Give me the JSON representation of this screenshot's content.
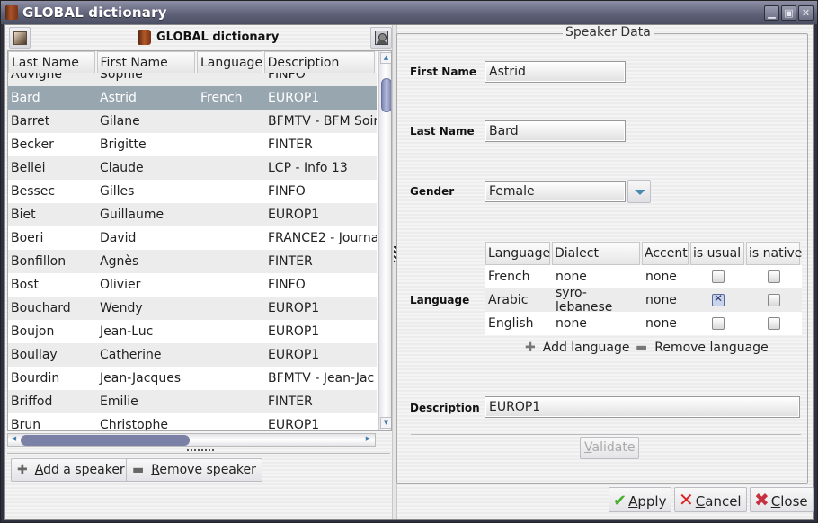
{
  "window": {
    "title": "GLOBAL dictionary",
    "controls": [
      "minimize",
      "maximize",
      "close"
    ]
  },
  "left_panel": {
    "title": "GLOBAL dictionary",
    "columns": [
      "Last Name",
      "First Name",
      "Language",
      "Description"
    ],
    "rows": [
      {
        "last": "Auvigne",
        "first": "Sophie",
        "language": "",
        "description": "FINFO"
      },
      {
        "last": "Bard",
        "first": "Astrid",
        "language": "French",
        "description": "EUROP1",
        "selected": true
      },
      {
        "last": "Barret",
        "first": "Gilane",
        "language": "",
        "description": "BFMTV - BFM Soir"
      },
      {
        "last": "Becker",
        "first": "Brigitte",
        "language": "",
        "description": "FINTER"
      },
      {
        "last": "Bellei",
        "first": "Claude",
        "language": "",
        "description": "LCP - Info 13"
      },
      {
        "last": "Bessec",
        "first": "Gilles",
        "language": "",
        "description": "FINFO"
      },
      {
        "last": "Biet",
        "first": "Guillaume",
        "language": "",
        "description": "EUROP1"
      },
      {
        "last": "Boeri",
        "first": "David",
        "language": "",
        "description": "FRANCE2 - Journa"
      },
      {
        "last": "Bonfillon",
        "first": "Agnès",
        "language": "",
        "description": "FINTER"
      },
      {
        "last": "Bost",
        "first": "Olivier",
        "language": "",
        "description": "FINFO"
      },
      {
        "last": "Bouchard",
        "first": "Wendy",
        "language": "",
        "description": "EUROP1"
      },
      {
        "last": "Boujon",
        "first": "Jean-Luc",
        "language": "",
        "description": "EUROP1"
      },
      {
        "last": "Boullay",
        "first": "Catherine",
        "language": "",
        "description": "EUROP1"
      },
      {
        "last": "Bourdin",
        "first": "Jean-Jacques",
        "language": "",
        "description": "BFMTV - Jean-Jac"
      },
      {
        "last": "Briffod",
        "first": "Emilie",
        "language": "",
        "description": "FINTER"
      },
      {
        "last": "Brun",
        "first": "Christophe",
        "language": "",
        "description": "EUROP1"
      }
    ],
    "add_speaker": {
      "label_prefix": "",
      "mnemonic": "A",
      "label_rest": "dd a speaker"
    },
    "remove_speaker": {
      "mnemonic": "R",
      "label_rest": "emove speaker"
    }
  },
  "speaker_data": {
    "legend": "Speaker Data",
    "first_name_label": "First Name",
    "first_name_value": "Astrid",
    "last_name_label": "Last Name",
    "last_name_value": "Bard",
    "gender_label": "Gender",
    "gender_value": "Female",
    "language_label": "Language",
    "language_columns": [
      "Language",
      "Dialect",
      "Accent",
      "is usual",
      "is native"
    ],
    "languages": [
      {
        "language": "French",
        "dialect": "none",
        "accent": "none",
        "is_usual": false,
        "is_native": false
      },
      {
        "language": "Arabic",
        "dialect": "syro-lebanese",
        "accent": "none",
        "is_usual": true,
        "is_native": false
      },
      {
        "language": "English",
        "dialect": "none",
        "accent": "none",
        "is_usual": false,
        "is_native": false
      }
    ],
    "add_language": "Add language",
    "remove_language": "Remove language",
    "description_label": "Description",
    "description_value": "EUROP1",
    "validate": {
      "mnemonic": "V",
      "label_rest": "alidate"
    }
  },
  "footer": {
    "apply": {
      "mnemonic": "A",
      "label_rest": "pply"
    },
    "cancel": {
      "mnemonic": "C",
      "label_rest": "ancel"
    },
    "close": {
      "mnemonic": "C",
      "label_rest": "lose"
    }
  },
  "colors": {
    "selection": "#98a6b0",
    "titlebar": "#5f6278",
    "scroll_thumb": "#7a80a6"
  }
}
